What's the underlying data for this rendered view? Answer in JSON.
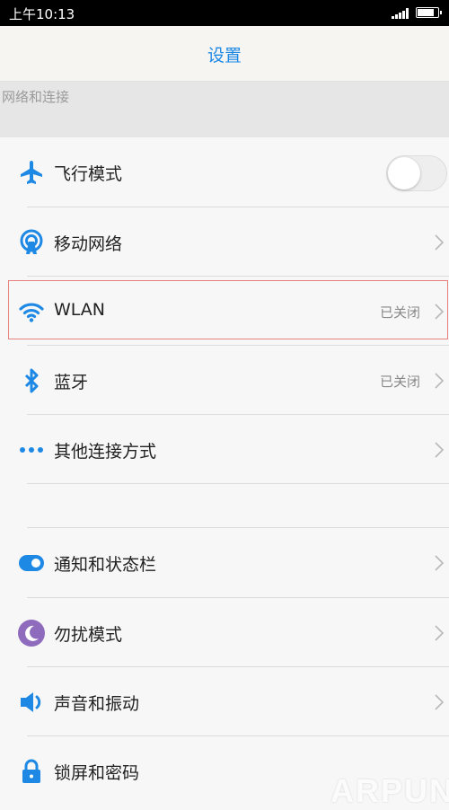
{
  "status_bar": {
    "time": "上午10:13"
  },
  "header": {
    "title": "设置"
  },
  "section": {
    "label": "网络和连接"
  },
  "items": [
    {
      "label": "飞行模式",
      "icon": "airplane-icon",
      "toggle_on": false
    },
    {
      "label": "移动网络",
      "icon": "mobile-network-icon"
    },
    {
      "label": "WLAN",
      "icon": "wifi-icon",
      "value": "已关闭"
    },
    {
      "label": "蓝牙",
      "icon": "bluetooth-icon",
      "value": "已关闭"
    },
    {
      "label": "其他连接方式",
      "icon": "more-dots-icon"
    },
    {
      "label": "通知和状态栏",
      "icon": "notification-toggle-icon"
    },
    {
      "label": "勿扰模式",
      "icon": "moon-icon"
    },
    {
      "label": "声音和振动",
      "icon": "speaker-icon"
    },
    {
      "label": "锁屏和密码",
      "icon": "lock-icon"
    }
  ],
  "watermark": "ARPUN",
  "colors": {
    "accent": "#1e88e5",
    "moon": "#8e6bbd",
    "highlight_border": "#e88080"
  }
}
